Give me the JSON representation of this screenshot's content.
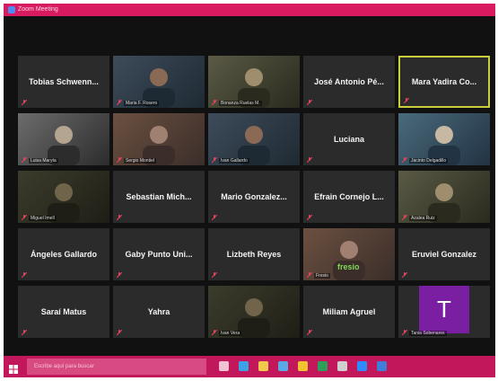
{
  "window": {
    "title": "Zoom Meeting"
  },
  "colors": {
    "titlebar": "#d81b60",
    "taskbar": "#c2185b",
    "active_border": "#c9cf3b",
    "tile_bg": "#2b2b2b",
    "avatar_bg": "#7b1fa2"
  },
  "participants": [
    {
      "display": "Tobias Schwenn...",
      "video": false,
      "active": false
    },
    {
      "display": "Maria F. Rosero",
      "video": true,
      "active": false
    },
    {
      "display": "Bonanza Ruelas M.",
      "video": true,
      "active": false
    },
    {
      "display": "José Antonio Pé...",
      "video": false,
      "active": false
    },
    {
      "display": "Mara Yadira Co...",
      "video": false,
      "active": true
    },
    {
      "display": "Luisa Maryta",
      "video": true,
      "active": false
    },
    {
      "display": "Sergio Montiel",
      "video": true,
      "active": false
    },
    {
      "display": "Ivan Gallardo",
      "video": true,
      "active": false
    },
    {
      "display": "Luciana",
      "video": false,
      "active": false
    },
    {
      "display": "Jacinto Delgadillo",
      "video": true,
      "active": false
    },
    {
      "display": "Miguel Imell",
      "video": true,
      "active": false
    },
    {
      "display": "Sebastian Mich...",
      "video": false,
      "active": false
    },
    {
      "display": "Mario Gonzalez...",
      "video": false,
      "active": false
    },
    {
      "display": "Efrain Cornejo L...",
      "video": false,
      "active": false
    },
    {
      "display": "Azalea Ruiz",
      "video": true,
      "active": false
    },
    {
      "display": "Ángeles Gallardo",
      "video": false,
      "active": false
    },
    {
      "display": "Gaby Punto Uni...",
      "video": false,
      "active": false
    },
    {
      "display": "Lizbeth Reyes",
      "video": false,
      "active": false
    },
    {
      "display": "Fresio",
      "video": true,
      "active": false,
      "shirt_text": "fresio"
    },
    {
      "display": "Eruviel Gonzalez",
      "video": false,
      "active": false
    },
    {
      "display": "Saraí Matus",
      "video": false,
      "active": false
    },
    {
      "display": "Yahra",
      "video": false,
      "active": false
    },
    {
      "display": "Ivan Vera",
      "video": true,
      "active": false
    },
    {
      "display": "Miliam Agruel",
      "video": false,
      "active": false
    },
    {
      "display": "Tania Sobenares",
      "video": false,
      "active": false,
      "avatar_letter": "T"
    }
  ],
  "taskbar": {
    "search_placeholder": "Escribe aquí para buscar",
    "icons": [
      "windows-start-icon",
      "task-view-icon",
      "edge-icon",
      "explorer-icon",
      "store-icon",
      "chrome-icon",
      "excel-icon",
      "calculator-icon",
      "zoom-icon",
      "mail-icon"
    ]
  }
}
